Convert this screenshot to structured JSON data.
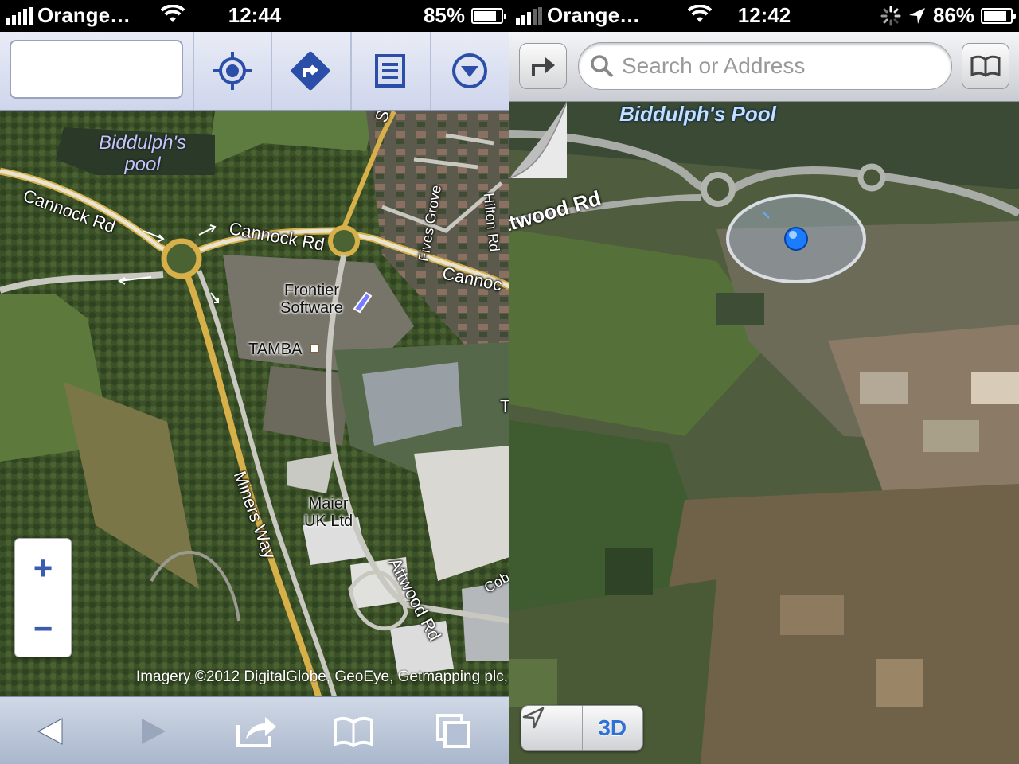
{
  "left": {
    "status": {
      "carrier": "Orange…",
      "time": "12:44",
      "battery": "85%",
      "battery_level": 0.85
    },
    "toolbar": {
      "search_value": "",
      "icons": [
        "my-location-icon",
        "directions-icon",
        "list-icon",
        "menu-dropdown-icon"
      ]
    },
    "map": {
      "water_label": "Biddulph's\npool",
      "roads": {
        "cannock_1": "Cannock Rd",
        "cannock_2": "Cannock Rd",
        "cannock_3": "Cannoc",
        "miners": "Miners Way",
        "attwood": "Attwood Rd",
        "fives": "Fives Grove",
        "hilton": "Hilton Rd",
        "s_road": "S",
        "cob": "Cob",
        "t_edge": "T"
      },
      "businesses": {
        "frontier": "Frontier\nSoftware",
        "tamba": "TAMBA",
        "maier": "Maier\nUK Ltd"
      },
      "zoom_in": "+",
      "zoom_out": "−",
      "attribution": "Imagery ©2012 DigitalGlobe, GeoEye, Getmapping plc,"
    },
    "safari_bar": [
      "back-icon",
      "forward-icon",
      "share-icon",
      "bookmarks-icon",
      "tabs-icon"
    ]
  },
  "right": {
    "status": {
      "carrier": "Orange…",
      "time": "12:42",
      "battery": "86%",
      "battery_level": 0.86
    },
    "toolbar": {
      "search_placeholder": "Search or Address"
    },
    "map": {
      "water_label": "Biddulph's Pool",
      "road_label": "ttwood Rd"
    },
    "controls": {
      "mode_3d": "3D"
    }
  },
  "colors": {
    "google_accent": "#2b4fa8",
    "ios_blue": "#2f6fd8",
    "road_yellow": "#d8b04a"
  }
}
